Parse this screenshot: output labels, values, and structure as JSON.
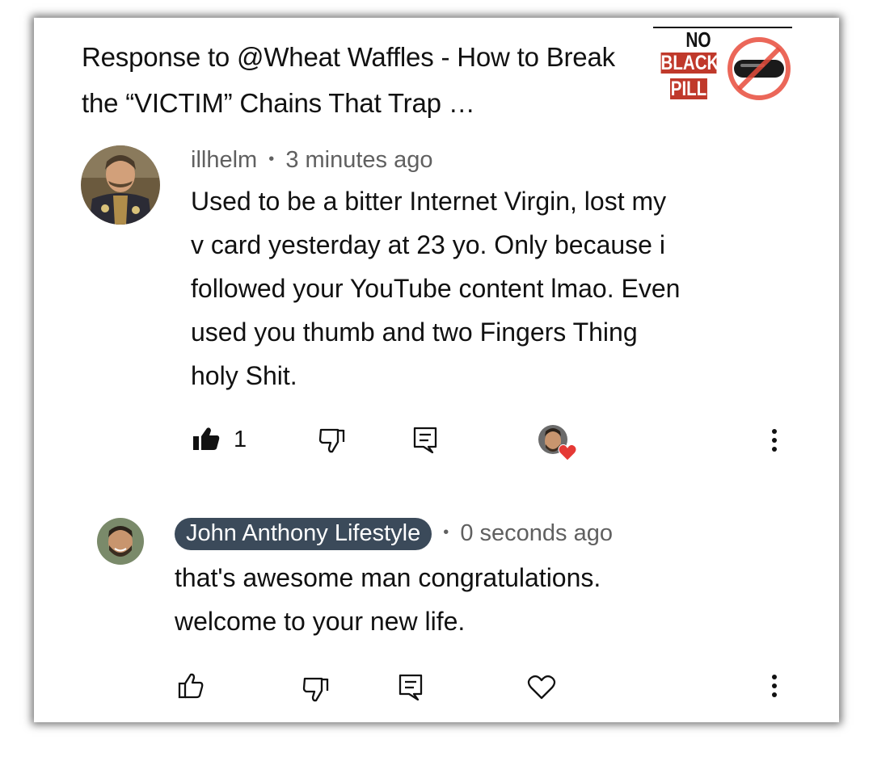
{
  "video": {
    "title": "Response to @Wheat Waffles - How to Break the “VICTIM” Chains That Trap …",
    "thumbnail_text": [
      "NO",
      "BLACK",
      "PILL"
    ]
  },
  "comment": {
    "author": "illhelm",
    "separator": "•",
    "time": "3 minutes ago",
    "text_lines": [
      "Used to be a bitter Internet Virgin, lost my",
      "v card yesterday at 23 yo. Only because i",
      "followed your YouTube content lmao. Even",
      "used you thumb and two Fingers Thing",
      "holy Shit."
    ],
    "like_count": "1",
    "liked": true,
    "hearted_by_creator": true
  },
  "reply": {
    "author": "John Anthony Lifestyle",
    "separator": "•",
    "time": "0 seconds ago",
    "text_lines": [
      "that's awesome man congratulations.",
      "welcome to your new life."
    ]
  },
  "colors": {
    "chip_bg": "#3b4a5a",
    "heart": "#e53935",
    "text": "#111111",
    "meta": "#606060",
    "badge_red": "#c0392b"
  },
  "icons": [
    "like-icon",
    "dislike-icon",
    "reply-icon",
    "heart-icon",
    "more-icon"
  ]
}
